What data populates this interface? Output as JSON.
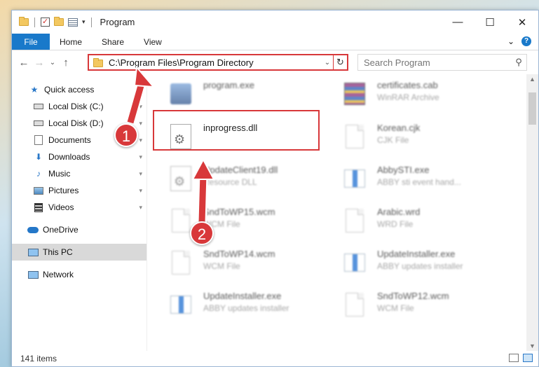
{
  "window": {
    "title": "Program",
    "controls": {
      "minimize": "—",
      "maximize": "☐",
      "close": "✕"
    }
  },
  "ribbon": {
    "file_tab": "File",
    "tabs": [
      "Home",
      "Share",
      "View"
    ],
    "expand_icon": "⌄",
    "help_icon": "?"
  },
  "nav": {
    "back": "←",
    "forward": "→",
    "recent": "⌄",
    "up": "↑",
    "address_path": "C:\\Program Files\\Program Directory",
    "address_dropdown": "⌄",
    "refresh": "↻",
    "search_placeholder": "Search Program",
    "search_icon": "⚲"
  },
  "sidebar": {
    "items": [
      {
        "label": "Quick access",
        "icon": "star-icon",
        "pinned": false
      },
      {
        "label": "Local Disk (C:)",
        "icon": "disk-icon",
        "pinned": true
      },
      {
        "label": "Local Disk (D:)",
        "icon": "disk-icon",
        "pinned": true
      },
      {
        "label": "Documents",
        "icon": "documents-icon",
        "pinned": true
      },
      {
        "label": "Downloads",
        "icon": "downloads-icon",
        "pinned": true
      },
      {
        "label": "Music",
        "icon": "music-icon",
        "pinned": true
      },
      {
        "label": "Pictures",
        "icon": "pictures-icon",
        "pinned": true
      },
      {
        "label": "Videos",
        "icon": "videos-icon",
        "pinned": true
      },
      {
        "label": "OneDrive",
        "icon": "onedrive-icon",
        "pinned": false
      },
      {
        "label": "This PC",
        "icon": "this-pc-icon",
        "pinned": false,
        "selected": true
      },
      {
        "label": "Network",
        "icon": "network-icon",
        "pinned": false
      }
    ],
    "pin_glyph": "📌"
  },
  "files": [
    {
      "name": "program.exe",
      "type": "",
      "icon": "exe-icon"
    },
    {
      "name": "certificates.cab",
      "type": "WinRAR Archive",
      "icon": "rar-icon"
    },
    {
      "name": "inprogress.dll",
      "type": "",
      "icon": "dll-gear-icon"
    },
    {
      "name": "Korean.cjk",
      "type": "CJK File",
      "icon": "file-icon"
    },
    {
      "name": "UpdateClient19.dll",
      "type": "Resource DLL",
      "icon": "dll-gear-icon"
    },
    {
      "name": "AbbySTI.exe",
      "type": "ABBY sti event hand...",
      "icon": "app-icon"
    },
    {
      "name": "SndToWP15.wcm",
      "type": "WCM File",
      "icon": "file-icon"
    },
    {
      "name": "Arabic.wrd",
      "type": "WRD File",
      "icon": "file-icon"
    },
    {
      "name": "SndToWP14.wcm",
      "type": "WCM File",
      "icon": "file-icon"
    },
    {
      "name": "UpdateInstaller.exe",
      "type": "ABBY updates installer",
      "icon": "app-icon"
    },
    {
      "name": "UpdateInstaller.exe",
      "type": "ABBY updates installer",
      "icon": "app-icon"
    },
    {
      "name": "SndToWP12.wcm",
      "type": "WCM File",
      "icon": "file-icon"
    }
  ],
  "status": {
    "item_count": "141 items"
  },
  "annotations": {
    "step1": "1",
    "step2": "2"
  },
  "colors": {
    "accent": "#1979ca",
    "highlight": "#d8383a"
  }
}
